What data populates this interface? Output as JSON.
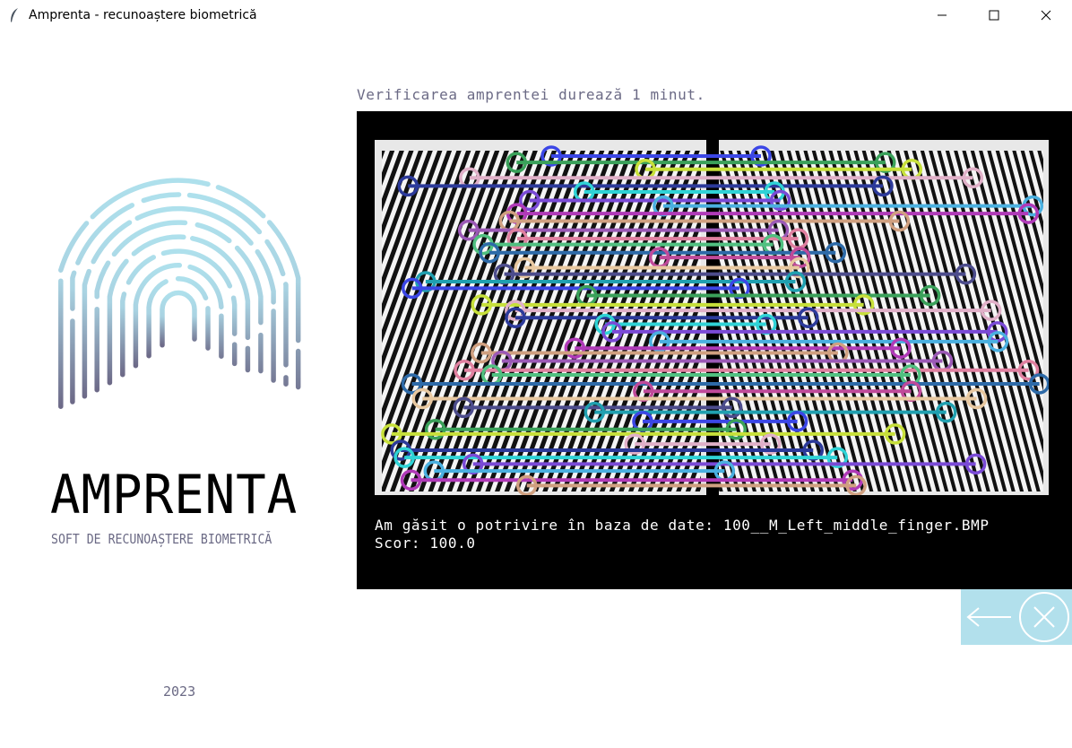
{
  "window": {
    "title": "Amprenta - recunoaștere biometrică",
    "minimize_icon": "minimize-icon",
    "maximize_icon": "maximize-icon",
    "close_icon": "close-icon"
  },
  "branding": {
    "name": "AMPRENTA",
    "tagline": "SOFT DE RECUNOAȘTERE BIOMETRICĂ",
    "year": "2023",
    "logo_icon": "fingerprint-icon",
    "logo_colors": [
      "#aee0ec",
      "#6d6a88"
    ]
  },
  "main": {
    "info_text": "Verificarea amprentei durează 1 minut.",
    "result_line1": "Am găsit o potrivire în baza de date: 100__M_Left_middle_finger.BMP",
    "result_line2": "Scor: 100.0"
  },
  "controls": {
    "back_icon": "arrow-left-icon",
    "cancel_icon": "x-circle-icon",
    "button_color": "#b2e0ec"
  }
}
